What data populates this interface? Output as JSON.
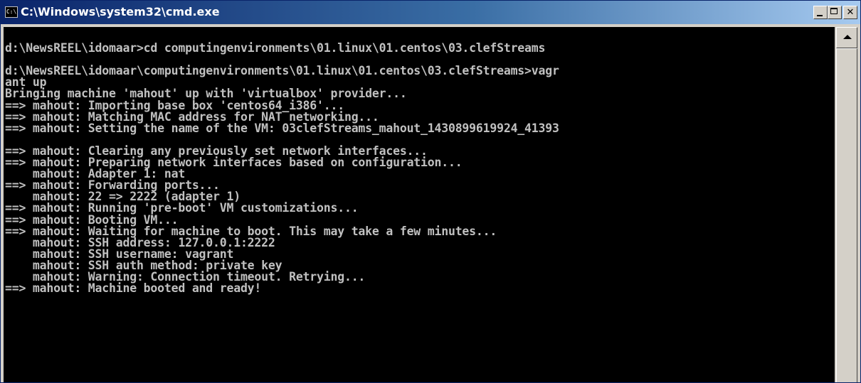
{
  "window": {
    "title": "C:\\Windows\\system32\\cmd.exe",
    "icon_label": "C:\\"
  },
  "title_buttons": {
    "minimize_icon": "minimize-icon",
    "maximize_icon": "maximize-icon",
    "close_label": "✕"
  },
  "console": {
    "lines": [
      "",
      "d:\\NewsREEL\\idomaar>cd computingenvironments\\01.linux\\01.centos\\03.clefStreams",
      "",
      "d:\\NewsREEL\\idomaar\\computingenvironments\\01.linux\\01.centos\\03.clefStreams>vagr",
      "ant up",
      "Bringing machine 'mahout' up with 'virtualbox' provider...",
      "==> mahout: Importing base box 'centos64_i386'...",
      "==> mahout: Matching MAC address for NAT networking...",
      "==> mahout: Setting the name of the VM: 03clefStreams_mahout_1430899619924_41393",
      "",
      "==> mahout: Clearing any previously set network interfaces...",
      "==> mahout: Preparing network interfaces based on configuration...",
      "    mahout: Adapter 1: nat",
      "==> mahout: Forwarding ports...",
      "    mahout: 22 => 2222 (adapter 1)",
      "==> mahout: Running 'pre-boot' VM customizations...",
      "==> mahout: Booting VM...",
      "==> mahout: Waiting for machine to boot. This may take a few minutes...",
      "    mahout: SSH address: 127.0.0.1:2222",
      "    mahout: SSH username: vagrant",
      "    mahout: SSH auth method: private key",
      "    mahout: Warning: Connection timeout. Retrying...",
      "==> mahout: Machine booted and ready!"
    ]
  },
  "scrollbar": {
    "up_icon": "scroll-up-arrow-icon"
  }
}
